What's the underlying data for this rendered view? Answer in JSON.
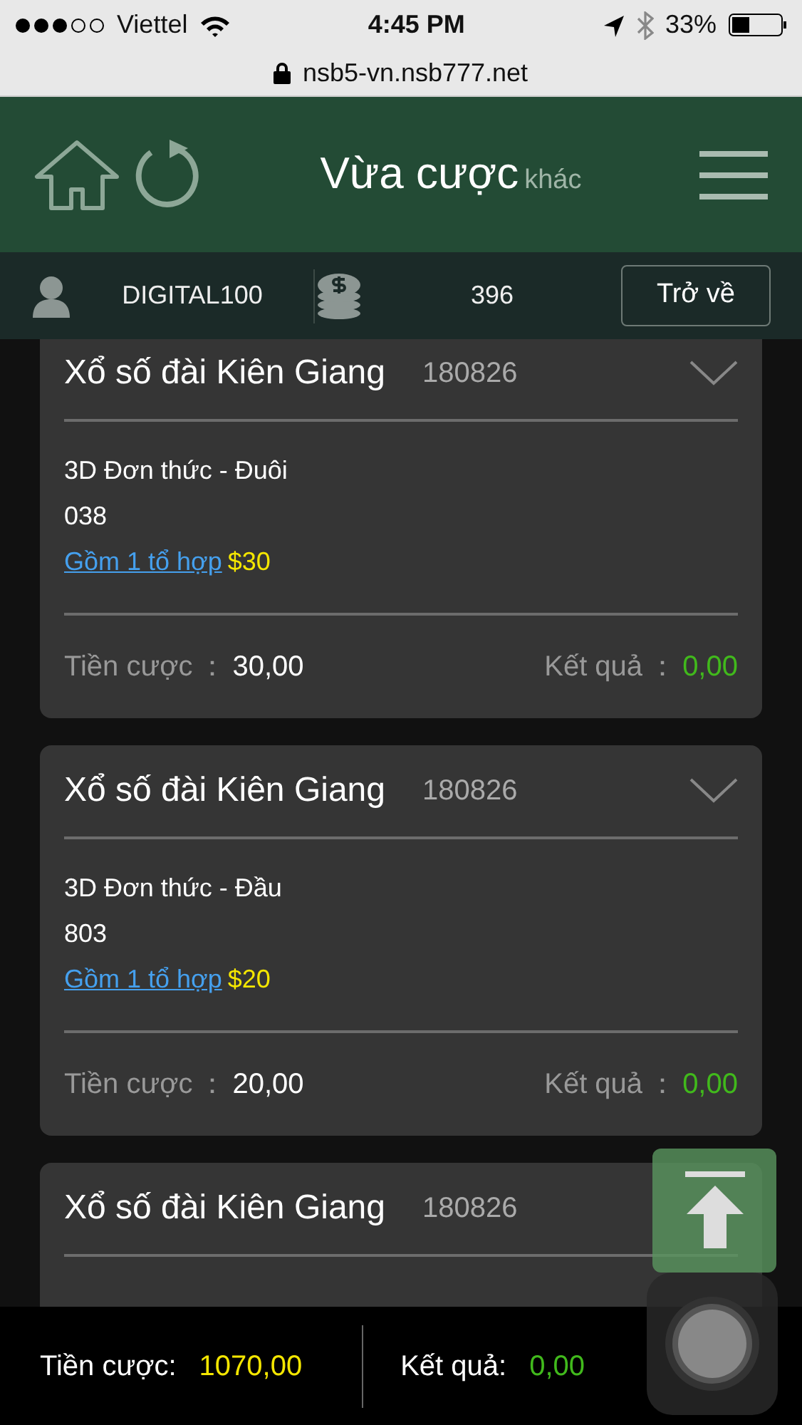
{
  "status_bar": {
    "carrier": "Viettel",
    "time": "4:45 PM",
    "battery": "33%"
  },
  "address_bar": {
    "url": "nsb5-vn.nsb777.net"
  },
  "header": {
    "title": "Vừa cược",
    "subtitle": "khác"
  },
  "account": {
    "username": "DIGITAL100",
    "balance": "396",
    "back_button": "Trở về"
  },
  "bets": [
    {
      "title": "Xổ số đài Kiên Giang",
      "draw": "180826",
      "bet_type": "3D Đơn thức - Đuôi",
      "numbers": "038",
      "combo_link": "Gồm 1 tổ hợp",
      "combo_amount": "$30",
      "stake_label": "Tiền cược",
      "stake_separator": "：",
      "stake": "30,00",
      "result_label": "Kết quả",
      "result_separator": "：",
      "result": "0,00"
    },
    {
      "title": "Xổ số đài Kiên Giang",
      "draw": "180826",
      "bet_type": "3D Đơn thức - Đầu",
      "numbers": "803",
      "combo_link": "Gồm 1 tổ hợp",
      "combo_amount": "$20",
      "stake_label": "Tiền cược",
      "stake_separator": "：",
      "stake": "20,00",
      "result_label": "Kết quả",
      "result_separator": "：",
      "result": "0,00"
    },
    {
      "title": "Xổ số đài Kiên Giang",
      "draw": "180826"
    }
  ],
  "footer": {
    "stake_label": "Tiền cược:",
    "stake": "1070,00",
    "result_label": "Kết quả:",
    "result": "0,00"
  }
}
